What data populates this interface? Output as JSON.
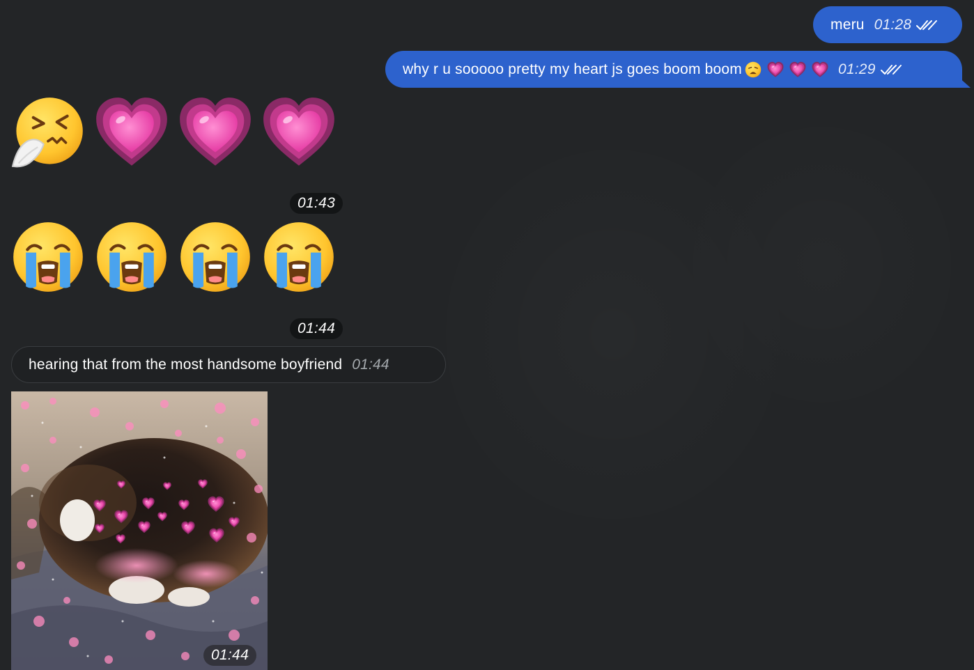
{
  "messages": {
    "out_1": {
      "text": "meru",
      "time": "01:28"
    },
    "out_2": {
      "text": "why r u sooooo pretty my heart js goes boom boom",
      "emojis": [
        "weary-face",
        "growing-heart",
        "growing-heart",
        "growing-heart"
      ],
      "time": "01:29"
    },
    "emoji_msg_1": {
      "emojis": [
        "sneezing-face",
        "growing-heart",
        "growing-heart",
        "growing-heart"
      ],
      "time": "01:43"
    },
    "emoji_msg_2": {
      "emojis": [
        "loudly-crying-face",
        "loudly-crying-face",
        "loudly-crying-face",
        "loudly-crying-face"
      ],
      "time": "01:44"
    },
    "in_1": {
      "text": "hearing that from the most handsome boyfriend",
      "time": "01:44"
    },
    "photo_1": {
      "subject": "cat-with-hearts-photo",
      "time": "01:44"
    }
  },
  "colors": {
    "background": "#232527",
    "outgoing_bubble": "#2d62cd",
    "incoming_bubble": "#1f2123",
    "time_pill": "#131516",
    "heart_pink": "#e63fa8",
    "emoji_yellow": "#ffcc33"
  }
}
